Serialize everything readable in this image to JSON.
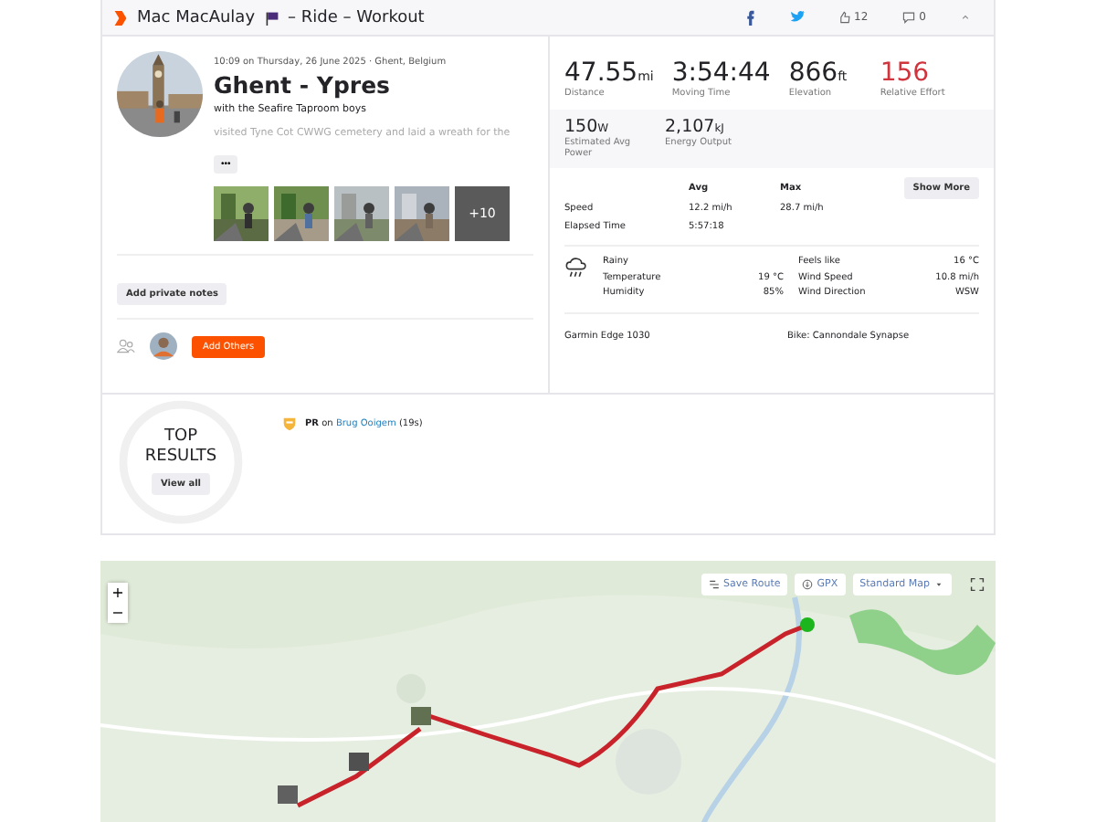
{
  "header": {
    "athlete": "Mac MacAulay",
    "activity_type": "– Ride – Workout",
    "kudos": "12",
    "comments": "0"
  },
  "activity": {
    "datetime": "10:09 on Thursday, 26 June 2025 · Ghent, Belgium",
    "title": "Ghent - Ypres",
    "with": "with the Seafire Taproom boys",
    "description": "visited Tyne Cot CWWG cemetery and laid a wreath for the",
    "more": "•••",
    "photos": [
      {
        "kind": "picture"
      },
      {
        "kind": "picture"
      },
      {
        "kind": "picture"
      },
      {
        "kind": "picture"
      },
      {
        "kind": "more",
        "label": "+10"
      }
    ],
    "private_notes_button": "Add private notes",
    "add_others_button": "Add Others"
  },
  "stats": {
    "primary": [
      {
        "value": "47.55",
        "unit": "mi",
        "label": "Distance",
        "color": "#242428"
      },
      {
        "value": "3:54:44",
        "label": "Moving Time",
        "color": "#242428"
      },
      {
        "value": "866",
        "unit": "ft",
        "label": "Elevation",
        "color": "#242428"
      },
      {
        "value": "156",
        "label": "Relative Effort",
        "color": "#d0343c"
      }
    ],
    "secondary": [
      {
        "value": "150",
        "unit": "W",
        "label": "Estimated Avg Power"
      },
      {
        "value": "2,107",
        "unit": "kJ",
        "label": "Energy Output"
      }
    ],
    "columns": [
      "Avg",
      "Max"
    ],
    "rows": [
      {
        "label": "Speed",
        "avg": "12.2 mi/h",
        "max": "28.7 mi/h"
      },
      {
        "label": "Elapsed Time",
        "avg": "5:57:18"
      }
    ],
    "show_more": "Show More"
  },
  "weather": {
    "condition": "Rainy",
    "left": [
      {
        "label": "Temperature",
        "value": "19 °C"
      },
      {
        "label": "Humidity",
        "value": "85%"
      }
    ],
    "right": [
      {
        "label": "Feels like",
        "value": "16 °C"
      },
      {
        "label": "Wind Speed",
        "value": "10.8 mi/h"
      },
      {
        "label": "Wind Direction",
        "value": "WSW"
      }
    ]
  },
  "gear": {
    "device": "Garmin Edge 1030",
    "bike": "Bike: Cannondale Synapse"
  },
  "top_results": {
    "title": "TOP RESULTS",
    "view_all": "View all",
    "achievements": [
      {
        "badge": "PR",
        "prefix": "on",
        "segment": "Brug Ooigem",
        "time": "(19s)"
      }
    ]
  },
  "map": {
    "kind": "picture",
    "zoom_in": "+",
    "zoom_out": "−",
    "save_route": "Save Route",
    "gpx": "GPX",
    "map_style": "Standard Map"
  }
}
